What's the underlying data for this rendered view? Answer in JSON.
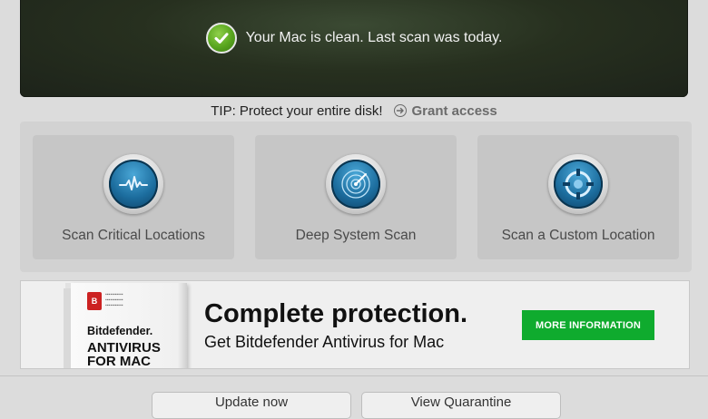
{
  "status": {
    "message": "Your Mac is clean. Last scan was today.",
    "icon": "checkmark-icon",
    "icon_color": "#58a51e"
  },
  "tip": {
    "text": "TIP: Protect your entire disk!",
    "link_label": "Grant access",
    "link_icon": "arrow-right-circle-icon"
  },
  "scans": [
    {
      "label": "Scan Critical Locations",
      "icon": "pulse-icon"
    },
    {
      "label": "Deep System Scan",
      "icon": "radar-icon"
    },
    {
      "label": "Scan a Custom Location",
      "icon": "target-icon"
    }
  ],
  "ad": {
    "product_brand": "Bitdefender.",
    "product_name_line1": "ANTIVIRUS",
    "product_name_line2": "FOR MAC",
    "headline": "Complete protection.",
    "subline": "Get Bitdefender Antivirus for Mac",
    "button_label": "MORE INFORMATION",
    "button_color": "#0fab2e"
  },
  "buttons": {
    "update": "Update now",
    "quarantine": "View Quarantine"
  }
}
